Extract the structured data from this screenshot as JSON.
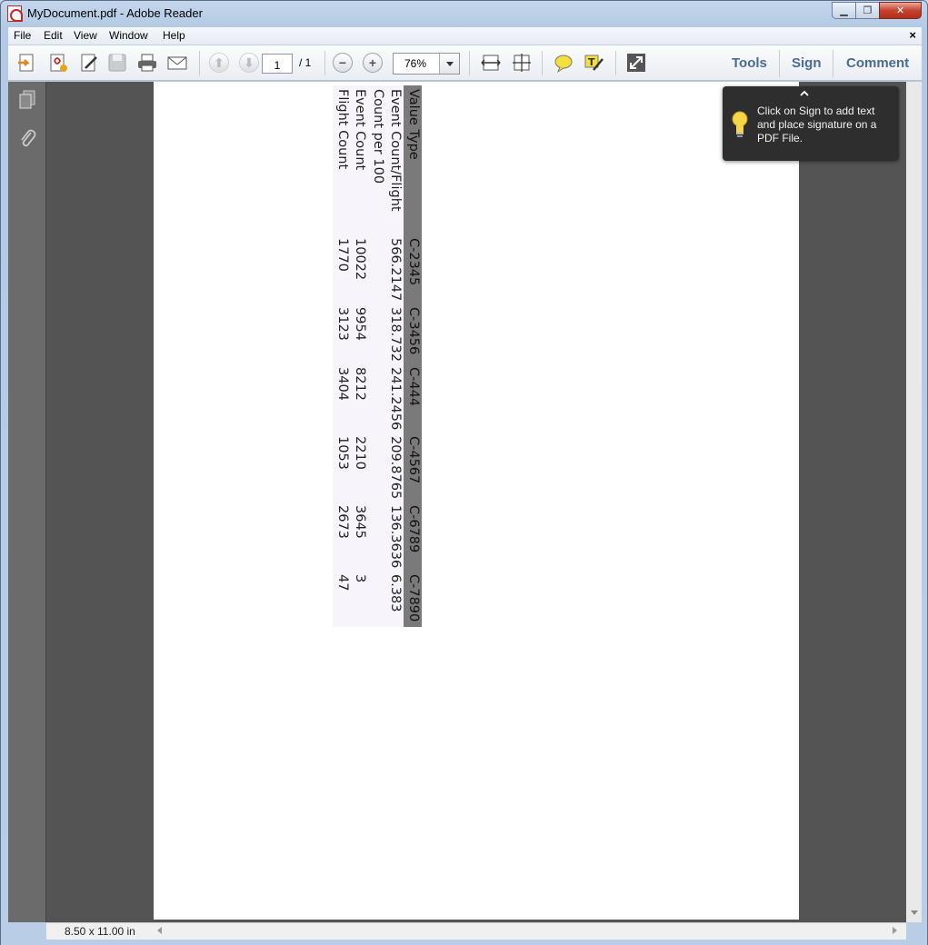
{
  "window": {
    "title": "MyDocument.pdf - Adobe Reader",
    "minimize": "▁",
    "maximize": "❐",
    "close": "✕"
  },
  "menu": {
    "file": "File",
    "edit": "Edit",
    "view": "View",
    "window": "Window",
    "help": "Help",
    "close_doc": "×"
  },
  "toolbar": {
    "page_current": "1",
    "page_total": "/ 1",
    "zoom": "76%",
    "tools": "Tools",
    "sign": "Sign",
    "comment": "Comment"
  },
  "status": {
    "page_size": "8.50 x 11.00 in"
  },
  "tooltip": {
    "text": "Click on Sign to add text and place signature on a PDF File."
  },
  "table": {
    "header": [
      "Value Type",
      "C-2345",
      "C-3456",
      "C-444",
      "C-4567",
      "C-6789",
      "C-7890"
    ],
    "rows": [
      [
        "Event Count/Flight",
        "566.2147",
        "318.732",
        "241.2456",
        "209.8765",
        "136.3636",
        "6.383"
      ],
      [
        "Count per 100",
        "",
        "",
        "",
        "",
        "",
        ""
      ],
      [
        "Event Count",
        "10022",
        "9954",
        "8212",
        "2210",
        "3645",
        "3"
      ],
      [
        "Flight Count",
        "1770",
        "3123",
        "3404",
        "1053",
        "2673",
        "47"
      ]
    ]
  },
  "colors": {
    "accent_link": "#4a6c91",
    "doc_background": "#545454",
    "table_header": "#7a7a7a",
    "tooltip_bg": "#2e2e2e"
  }
}
